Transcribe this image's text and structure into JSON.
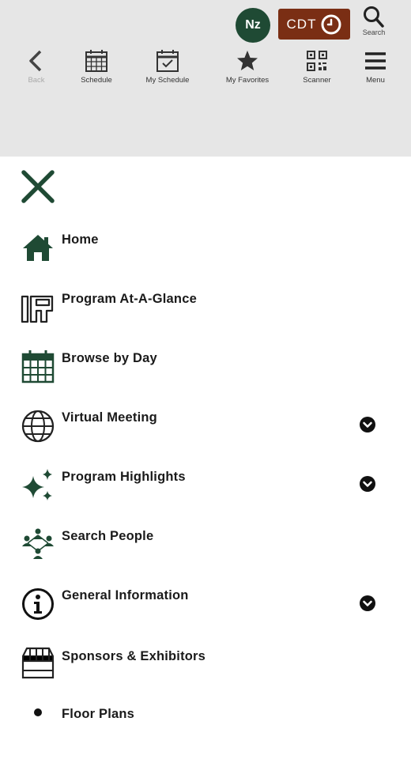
{
  "header": {
    "avatar_initials": "Nz",
    "timezone_label": "CDT",
    "search_label": "Search",
    "nav": [
      {
        "label": "Back"
      },
      {
        "label": "Schedule"
      },
      {
        "label": "My Schedule"
      },
      {
        "label": "My Favorites"
      },
      {
        "label": "Scanner"
      },
      {
        "label": "Menu"
      }
    ]
  },
  "colors": {
    "accent": "#1f4a34",
    "timezone_bg": "#7a2e14",
    "header_bg": "#e6e6e6"
  },
  "menu": {
    "items": [
      {
        "label": "Home",
        "icon": "home-icon"
      },
      {
        "label": "Program At-A-Glance",
        "icon": "program-glance-icon"
      },
      {
        "label": "Browse by Day",
        "icon": "calendar-icon"
      },
      {
        "label": "Virtual Meeting",
        "icon": "globe-icon",
        "expandable": true
      },
      {
        "label": "Program Highlights",
        "icon": "sparkle-icon",
        "expandable": true
      },
      {
        "label": "Search People",
        "icon": "people-icon"
      },
      {
        "label": "General Information",
        "icon": "info-icon",
        "expandable": true
      },
      {
        "label": "Sponsors & Exhibitors",
        "icon": "storefront-icon"
      },
      {
        "label": "Floor Plans",
        "icon": "map-pin-icon"
      }
    ]
  }
}
